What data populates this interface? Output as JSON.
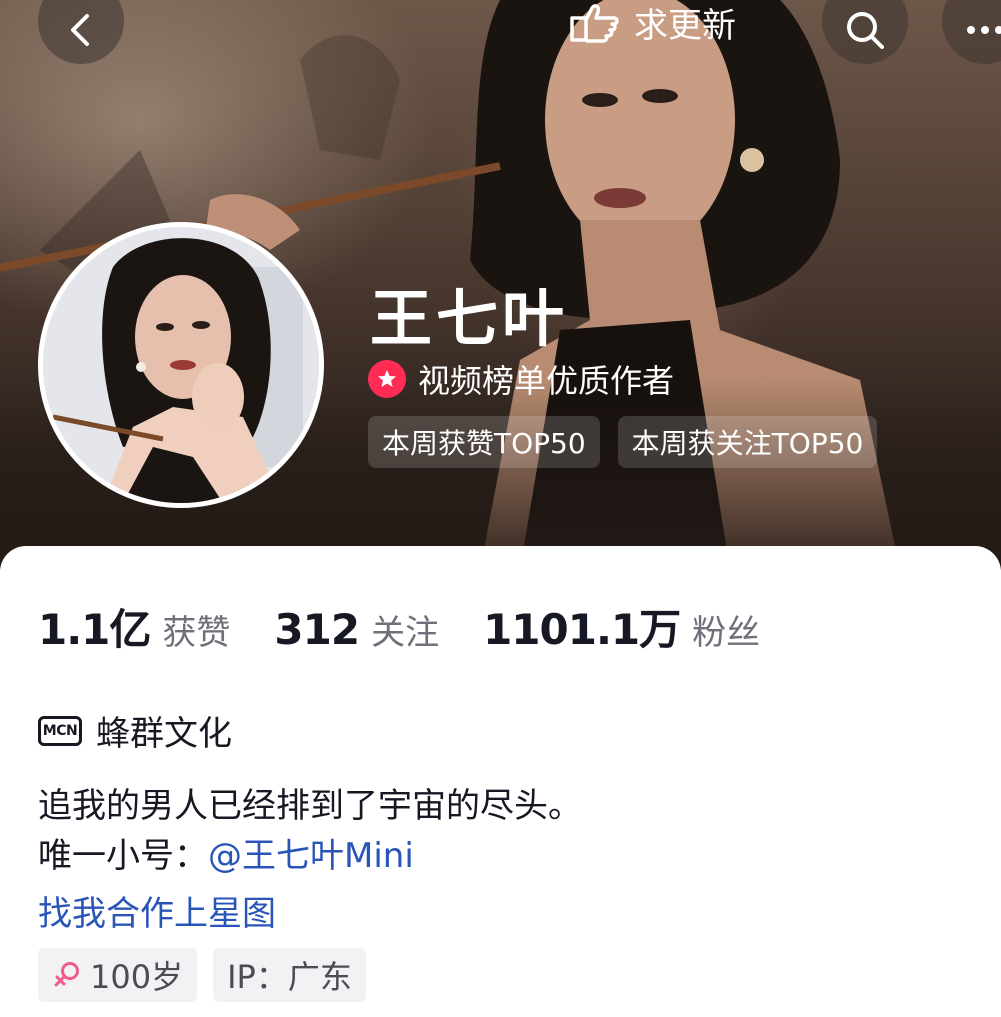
{
  "header": {
    "update_label": "求更新",
    "icons": [
      "back-icon",
      "hand-pointing-icon",
      "search-icon",
      "more-icon"
    ]
  },
  "profile": {
    "nickname": "王七叶",
    "certification": "视频榜单优质作者",
    "rank_badges": [
      "本周获赞TOP50",
      "本周获关注TOP50"
    ]
  },
  "stats": [
    {
      "value": "1.1亿",
      "label": "获赞"
    },
    {
      "value": "312",
      "label": "关注"
    },
    {
      "value": "1101.1万",
      "label": "粉丝"
    }
  ],
  "mcn": {
    "icon_text": "MCN",
    "name": "蜂群文化"
  },
  "bio": {
    "line1": "追我的男人已经排到了宇宙的尽头。",
    "line2_prefix": "唯一小号：",
    "line2_mention": "@王七叶Mini",
    "cooperation_link": "找我合作上星图"
  },
  "tags": {
    "age": "100岁",
    "ip": "IP：广东"
  },
  "colors": {
    "accent": "#fe2c55",
    "link": "#2a55b8",
    "female": "#f05a8e"
  }
}
